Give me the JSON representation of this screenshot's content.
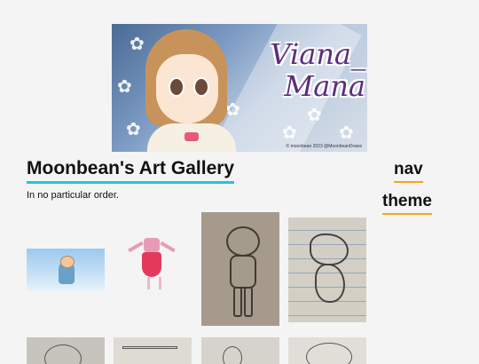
{
  "header": {
    "banner_logo": "Viana_\nMana",
    "banner_credit": "© moonbean 2023 @MoonbeanDraws"
  },
  "gallery": {
    "title": "Moonbean's Art Gallery",
    "subtitle": "In no particular order."
  },
  "side_links": {
    "nav": "nav",
    "theme": "theme"
  },
  "colors": {
    "title_underline": "#1fc8d8",
    "link_underline": "#f3a51c",
    "background": "#f4f4f4"
  },
  "icons": [
    "flower-icon"
  ]
}
